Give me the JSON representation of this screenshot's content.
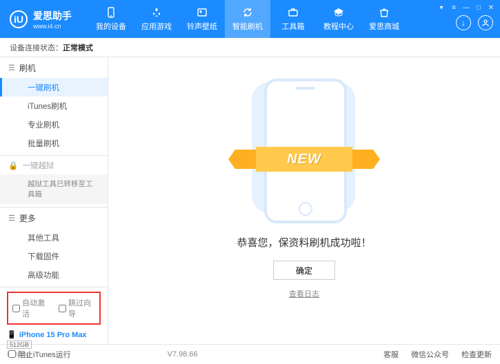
{
  "brand": {
    "title": "爱思助手",
    "url": "www.i4.cn",
    "logo_char": "iU"
  },
  "nav": [
    {
      "label": "我的设备"
    },
    {
      "label": "应用游戏"
    },
    {
      "label": "铃声壁纸"
    },
    {
      "label": "智能刷机",
      "active": true
    },
    {
      "label": "工具箱"
    },
    {
      "label": "教程中心"
    },
    {
      "label": "爱思商城"
    }
  ],
  "status": {
    "prefix": "设备连接状态：",
    "mode": "正常模式"
  },
  "sidebar": {
    "flash": {
      "head": "刷机",
      "items": [
        {
          "label": "一键刷机",
          "active": true
        },
        {
          "label": "iTunes刷机"
        },
        {
          "label": "专业刷机"
        },
        {
          "label": "批量刷机"
        }
      ]
    },
    "jailbreak": {
      "head": "一键越狱",
      "note": "越狱工具已转移至工具箱"
    },
    "more": {
      "head": "更多",
      "items": [
        {
          "label": "其他工具"
        },
        {
          "label": "下载固件"
        },
        {
          "label": "高级功能"
        }
      ]
    },
    "options": {
      "auto_activate": "自动激活",
      "skip_guide": "跳过向导"
    },
    "device": {
      "name": "iPhone 15 Pro Max",
      "storage": "512GB",
      "type": "iPhone"
    }
  },
  "main": {
    "ribbon": "NEW",
    "success": "恭喜您，保资料刷机成功啦！",
    "ok": "确定",
    "log": "查看日志"
  },
  "footer": {
    "block_itunes": "阻止iTunes运行",
    "version": "V7.98.66",
    "links": {
      "support": "客服",
      "wechat": "微信公众号",
      "update": "检查更新"
    }
  }
}
